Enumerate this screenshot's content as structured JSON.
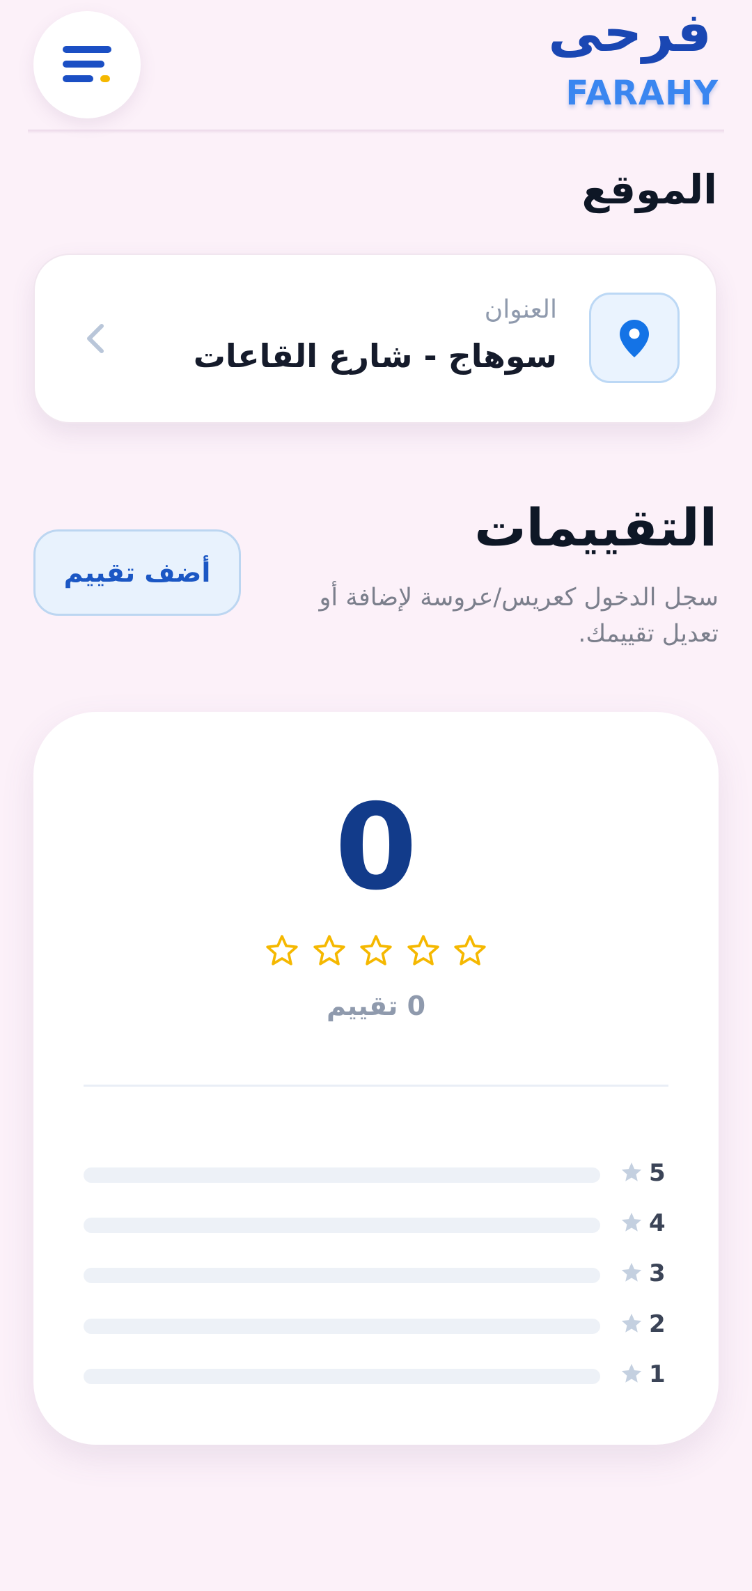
{
  "header": {
    "logo_ar": "فرحى",
    "logo_en": "FARAHY",
    "menu_icon": "menu-icon"
  },
  "location": {
    "title": "الموقع",
    "address_label": "العنوان",
    "address_value": "سوهاج - شارع القاعات"
  },
  "reviews": {
    "title": "التقييمات",
    "subtitle": "سجل الدخول كعريس/عروسة لإضافة أو تعديل تقييمك.",
    "add_button": "أضف تقييم",
    "score": "0",
    "count_text": "0 تقييم",
    "stars_filled": 0,
    "stars_total": 5,
    "distribution": [
      {
        "label": "5",
        "value": 0
      },
      {
        "label": "4",
        "value": 0
      },
      {
        "label": "3",
        "value": 0
      },
      {
        "label": "2",
        "value": 0
      },
      {
        "label": "1",
        "value": 0
      }
    ]
  },
  "colors": {
    "background": "#fcf1f9",
    "primary": "#1a47b3",
    "accent": "#f5b800",
    "pin": "#1473e6"
  }
}
